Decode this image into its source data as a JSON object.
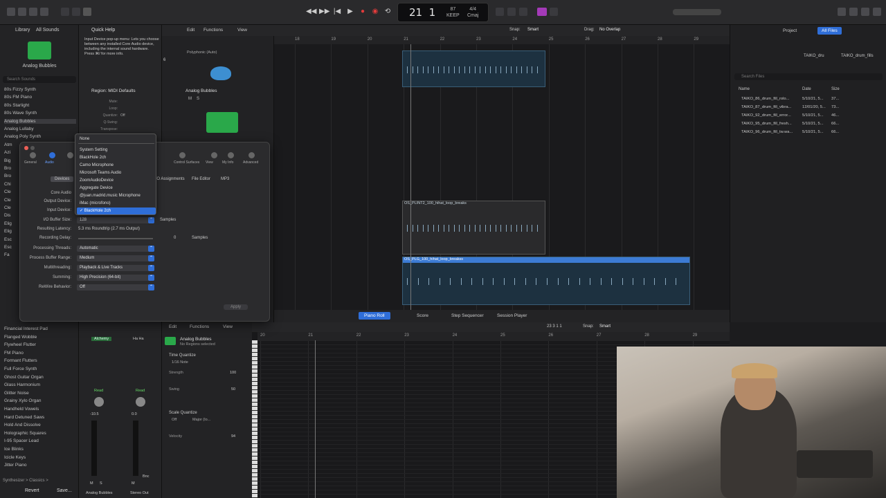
{
  "transport": {
    "position_bar": "21",
    "position_beat": "1",
    "tempo": "87",
    "tempo_label": "KEEP",
    "signature": "4/4",
    "key": "Cmaj",
    "counter_badge": "1234"
  },
  "library": {
    "title": "Library",
    "filter": "All Sounds",
    "selected_patch": "Analog Bubbles",
    "search_placeholder": "Search Sounds",
    "items": [
      "80s Fizzy Synth",
      "80s FM Piano",
      "80s Starlight",
      "80s Wave Synth",
      "Analog Bubbles",
      "Analog Lullaby",
      "Analog Poly Synth",
      "Atm",
      "Azi",
      "Big",
      "Bro",
      "Bro",
      "Chi",
      "Cle",
      "Cle",
      "Cle",
      "Dis",
      "Elig",
      "Elig",
      "Esc",
      "Esc",
      "Fa"
    ],
    "items_lower": [
      "Financial Interest Pad",
      "Flanged Wobble",
      "Flywheel Flutter",
      "FM Piano",
      "Formant Flutters",
      "Full Force Synth",
      "Ghost Guitar Organ",
      "Glass Harmonium",
      "Glitter Noise",
      "Grainy Xylo Organ",
      "Handheld Vowels",
      "Hard Detuned Saws",
      "Hold And Dissolve",
      "Holographic Squares",
      "I-95 Spacer Lead",
      "Ice Blinks",
      "Icicle Keys",
      "Jitter Piano"
    ],
    "footer_path": "Synthesizer > Classics >",
    "revert": "Revert",
    "save": "Save..."
  },
  "quick_help": {
    "title": "Quick Help",
    "text": "Input Device pop-up menu: Lets you choose between any installed Core Audio device, including the internal sound hardware. Press ⌘/ for more info."
  },
  "region_inspector": {
    "title": "Region: MIDI Defaults",
    "rows": [
      "Mute:",
      "Loop:",
      "Quantize:",
      "Q-Swing:",
      "Transpose:"
    ],
    "quantize_value": "Off"
  },
  "tracks": {
    "track_num": "6",
    "track1": "Polyphonic (Auto)",
    "track2": "Analog Bubbles",
    "mute": "M",
    "solo": "S"
  },
  "arrange": {
    "menu": [
      "Edit",
      "Functions",
      "View"
    ],
    "snap_label": "Snap:",
    "snap_value": "Smart",
    "drag_label": "Drag:",
    "drag_value": "No Overlap",
    "ruler": [
      "18",
      "19",
      "20",
      "21",
      "22",
      "23",
      "24",
      "25",
      "26",
      "27",
      "28",
      "29"
    ],
    "region2_name": "OS_PLINT2_100_hihat_loop_breaks",
    "region3_name": "OS_PLG_100_hihat_loop_breakss"
  },
  "browser": {
    "tab_project": "Project",
    "tab_allfiles": "All Files",
    "path": "TAIKO_dru",
    "path2": "TAIKO_drum_fills",
    "search_placeholder": "Search Files",
    "cols": [
      "Name",
      "Date",
      "Size"
    ],
    "files": [
      {
        "name": "TAIKO_86_drum_fill_rolo...",
        "date": "5/10/21, 5...",
        "size": "37..."
      },
      {
        "name": "TAIKO_87_drum_fill_vibra...",
        "date": "12/01/20, 5...",
        "size": "73..."
      },
      {
        "name": "TAIKO_92_drum_fill_error...",
        "date": "5/10/21, 5...",
        "size": "46..."
      },
      {
        "name": "TAIKO_95_drum_fill_fresh...",
        "date": "5/10/21, 5...",
        "size": "66..."
      },
      {
        "name": "TAIKO_96_drum_fill_tw.wa...",
        "date": "5/10/21, 5...",
        "size": "66..."
      }
    ]
  },
  "prefs": {
    "tabs": [
      "General",
      "Audio",
      "Recording",
      "Editing",
      "Automation",
      "Control Surfaces",
      "View",
      "My Info",
      "Advanced"
    ],
    "subtabs": [
      "Devices",
      "I/O Assignments",
      "File Editor",
      "MP3"
    ],
    "core_audio": "Core Audio",
    "output_device_label": "Output Device:",
    "input_device_label": "Input Device:",
    "buffer_label": "I/O Buffer Size:",
    "buffer_value": "128",
    "samples": "Samples",
    "latency_label": "Resulting Latency:",
    "latency_value": "5.3 ms Roundtrip (2.7 ms Output)",
    "rec_delay_label": "Recording Delay:",
    "rec_delay_value": "0",
    "threads_label": "Processing Threads:",
    "threads_value": "Automatic",
    "pbr_label": "Process Buffer Range:",
    "pbr_value": "Medium",
    "mt_label": "Multithreading:",
    "mt_value": "Playback & Live Tracks",
    "sum_label": "Summing:",
    "sum_value": "High Precision (64-bit)",
    "rewire_label": "ReWire Behavior:",
    "rewire_value": "Off",
    "apply": "Apply"
  },
  "dropdown": {
    "items": [
      "None",
      "System Setting",
      "BlackHole 2ch",
      "Camo Microphone",
      "Microsoft Teams Audio",
      "ZoomAudioDevice",
      "Aggregate Device",
      "@juan.madrid.music Microphone",
      "iMac (microfono)",
      "BlackHole 2ch"
    ],
    "selected_index": 9
  },
  "bottom": {
    "tabs": [
      "Piano Roll",
      "Score",
      "Step Sequencer",
      "Session Player"
    ],
    "active": "Piano Roll",
    "pr_menu": [
      "Edit",
      "Functions",
      "View"
    ],
    "pr_snap_label": "Snap:",
    "pr_snap_value": "Smart",
    "pr_position": "23 3 1 1",
    "pr_ruler": [
      "20",
      "21",
      "22",
      "23",
      "24",
      "25",
      "26",
      "27",
      "28",
      "29"
    ],
    "track_name": "Analog Bubbles",
    "track_sub": "No Regions selected",
    "time_quantize": "Time Quantize",
    "tq_value": "1/16 Note",
    "strength": "Strength",
    "strength_val": "100",
    "swing": "Swing",
    "swing_val": "50",
    "scale_quantize": "Scale Quantize",
    "sq_off": "Off",
    "sq_major": "Major (Io...",
    "velocity": "Velocity",
    "velocity_val": "94"
  },
  "mixer": {
    "strip1_plugin": "Alchemy",
    "strip2_plugin": "Ha Ha",
    "strip1_name": "Analog Bubbles",
    "strip2_name": "Stereo Out",
    "read": "Read",
    "group": "Group",
    "vol1": "-10.5",
    "vol2": "0.0",
    "m": "M",
    "s": "S",
    "bnc": "Bnc"
  }
}
